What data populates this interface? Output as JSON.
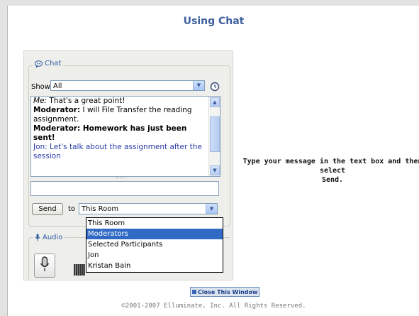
{
  "page": {
    "title": "Using Chat",
    "instruction_line1": "Type your message in the text box and then select",
    "instruction_line2": "Send."
  },
  "chat_panel": {
    "legend": "Chat",
    "show_label": "Show",
    "show_value": "All",
    "transcript": [
      {
        "speaker": "Me:",
        "text": " That's a great point!",
        "style": "normal"
      },
      {
        "speaker": "Moderator:",
        "text": " I will File Transfer the reading assignment.",
        "style": "normal"
      },
      {
        "speaker": "Moderator: Homework has just been sent!",
        "text": "",
        "style": "bold"
      },
      {
        "speaker": "Jon: Let's talk about the assignment after the session",
        "text": "",
        "style": "blue"
      }
    ],
    "message_value": "",
    "send_label": "Send",
    "to_label": "to",
    "to_value": "This Room",
    "to_options": [
      "This Room",
      "Moderators",
      "Selected Participants",
      "Jon",
      "Kristan Bain"
    ],
    "selected_option_index": 1
  },
  "audio_panel": {
    "legend": "Audio"
  },
  "footer": {
    "close_label": "Close This Window",
    "copyright": "©2001-2007 Elluminate, Inc. All Rights Reserved."
  },
  "icons": {
    "chat": "chat-bubble-icon",
    "audio": "microphone-icon",
    "history": "clock-icon",
    "dropdown": "chevron-down-icon"
  },
  "colors": {
    "title": "#3d5f9d",
    "selection": "#316ac5",
    "panel_bg": "#eeeeea",
    "blue_message": "#2a3ca8"
  }
}
